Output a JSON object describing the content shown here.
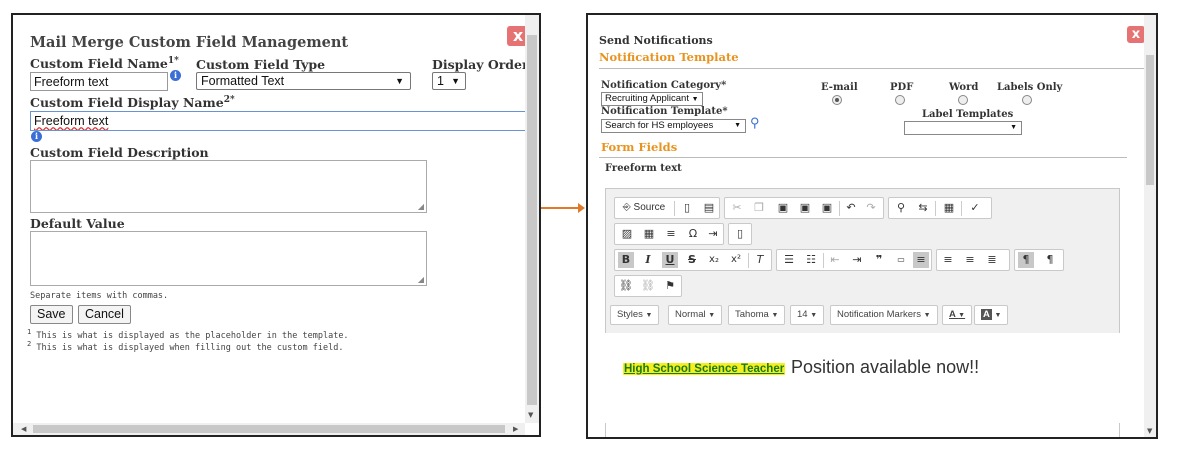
{
  "left": {
    "title": "Mail Merge Custom Field Management",
    "close_label": "x",
    "custom_field_name_label": "Custom Field Name",
    "custom_field_name_sup": "1*",
    "custom_field_name_value": "Freeform text",
    "custom_field_type_label": "Custom Field Type",
    "custom_field_type_value": "Formatted Text",
    "display_order_label": "Display Order",
    "display_order_value": "1",
    "display_name_label": "Custom Field Display Name",
    "display_name_sup": "2*",
    "display_name_value": "Freeform text",
    "description_label": "Custom Field Description",
    "default_value_label": "Default Value",
    "separate_note": "Separate items with commas.",
    "save_label": "Save",
    "cancel_label": "Cancel",
    "footnote1_num": "1",
    "footnote1": "This is what is displayed as the placeholder in the template.",
    "footnote2_num": "2",
    "footnote2": "This is what is displayed when filling out the custom field."
  },
  "right": {
    "title": "Send Notifications",
    "close_label": "x",
    "section_template": "Notification Template",
    "category_label": "Notification Category*",
    "category_value": "Recruiting Applicant",
    "template_label": "Notification Template*",
    "template_value": "Search for HS employees",
    "formats": [
      "E-mail",
      "PDF",
      "Word",
      "Labels Only"
    ],
    "selected_format": "E-mail",
    "label_templates_label": "Label Templates",
    "label_templates_value": "",
    "section_form_fields": "Form Fields",
    "field_label": "Freeform text",
    "toolbar": {
      "source_label": "Source",
      "styles_label": "Styles",
      "format_label": "Normal",
      "font_label": "Tahoma",
      "size_label": "14",
      "markers_label": "Notification Markers"
    },
    "content": {
      "marker_text": "High School Science Teacher",
      "body_text": "Position available now!!"
    }
  },
  "colors": {
    "accent_orange": "#e8931e",
    "close_red": "#e57373",
    "marker_yellow": "#f5ef1e",
    "marker_green": "#1a7a1a",
    "arrow": "#e07a2a"
  }
}
